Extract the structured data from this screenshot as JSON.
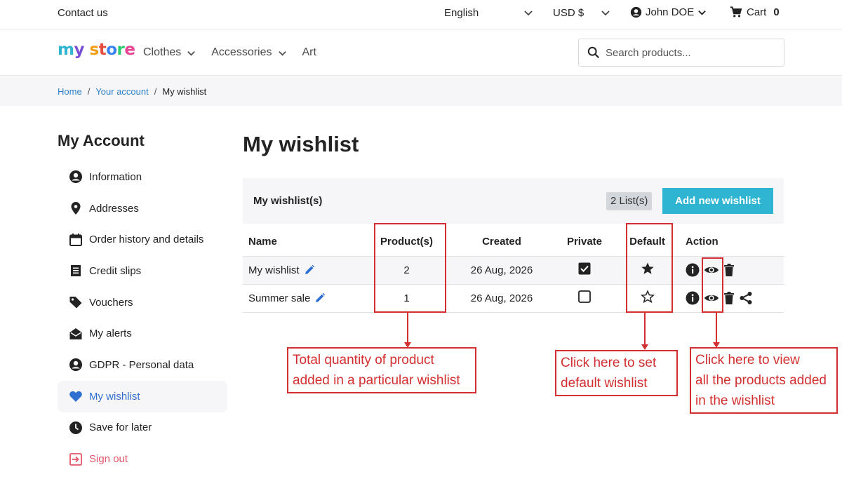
{
  "topbar": {
    "contact": "Contact us",
    "language": "English",
    "currency": "USD $",
    "user": "John DOE",
    "cart_label": "Cart",
    "cart_count": "0"
  },
  "header": {
    "logo_parts": [
      "m",
      "y",
      " ",
      "s",
      "t",
      "o",
      "r",
      "e"
    ],
    "nav": [
      "Clothes",
      "Accessories",
      "Art"
    ],
    "search_placeholder": "Search products..."
  },
  "breadcrumb": {
    "home": "Home",
    "account": "Your account",
    "current": "My wishlist"
  },
  "sidebar": {
    "title": "My Account",
    "items": [
      {
        "label": "Information",
        "icon": "user-circle-icon"
      },
      {
        "label": "Addresses",
        "icon": "location-pin-icon"
      },
      {
        "label": "Order history and details",
        "icon": "calendar-icon"
      },
      {
        "label": "Credit slips",
        "icon": "receipt-icon"
      },
      {
        "label": "Vouchers",
        "icon": "tag-icon"
      },
      {
        "label": "My alerts",
        "icon": "envelope-open-icon"
      },
      {
        "label": "GDPR - Personal data",
        "icon": "user-circle-icon"
      },
      {
        "label": "My wishlist",
        "icon": "heart-icon"
      },
      {
        "label": "Save for later",
        "icon": "clock-icon"
      },
      {
        "label": "Sign out",
        "icon": "sign-out-icon"
      }
    ]
  },
  "main": {
    "title": "My wishlist",
    "panel_label": "My wishlist(s)",
    "list_count": "2 List(s)",
    "add_button": "Add new wishlist",
    "columns": [
      "Name",
      "Product(s)",
      "Created",
      "Private",
      "Default",
      "Action"
    ],
    "rows": [
      {
        "name": "My wishlist",
        "products": "2",
        "created": "26 Aug, 2026",
        "private": true,
        "default": true,
        "share": false
      },
      {
        "name": "Summer sale",
        "products": "1",
        "created": "26 Aug, 2026",
        "private": false,
        "default": false,
        "share": true
      }
    ]
  },
  "annotations": {
    "products_note_1": "Total quantity of product",
    "products_note_2": "added in a particular wishlist",
    "default_note_1": "Click here to set",
    "default_note_2": "default wishlist",
    "view_note_1": "Click here to view",
    "view_note_2": "all the products added",
    "view_note_3": "in the wishlist"
  },
  "colors": {
    "accent": "#2fb5d2",
    "link": "#2f80c8",
    "annotation": "#d32f2f",
    "signout": "#e5566b"
  }
}
